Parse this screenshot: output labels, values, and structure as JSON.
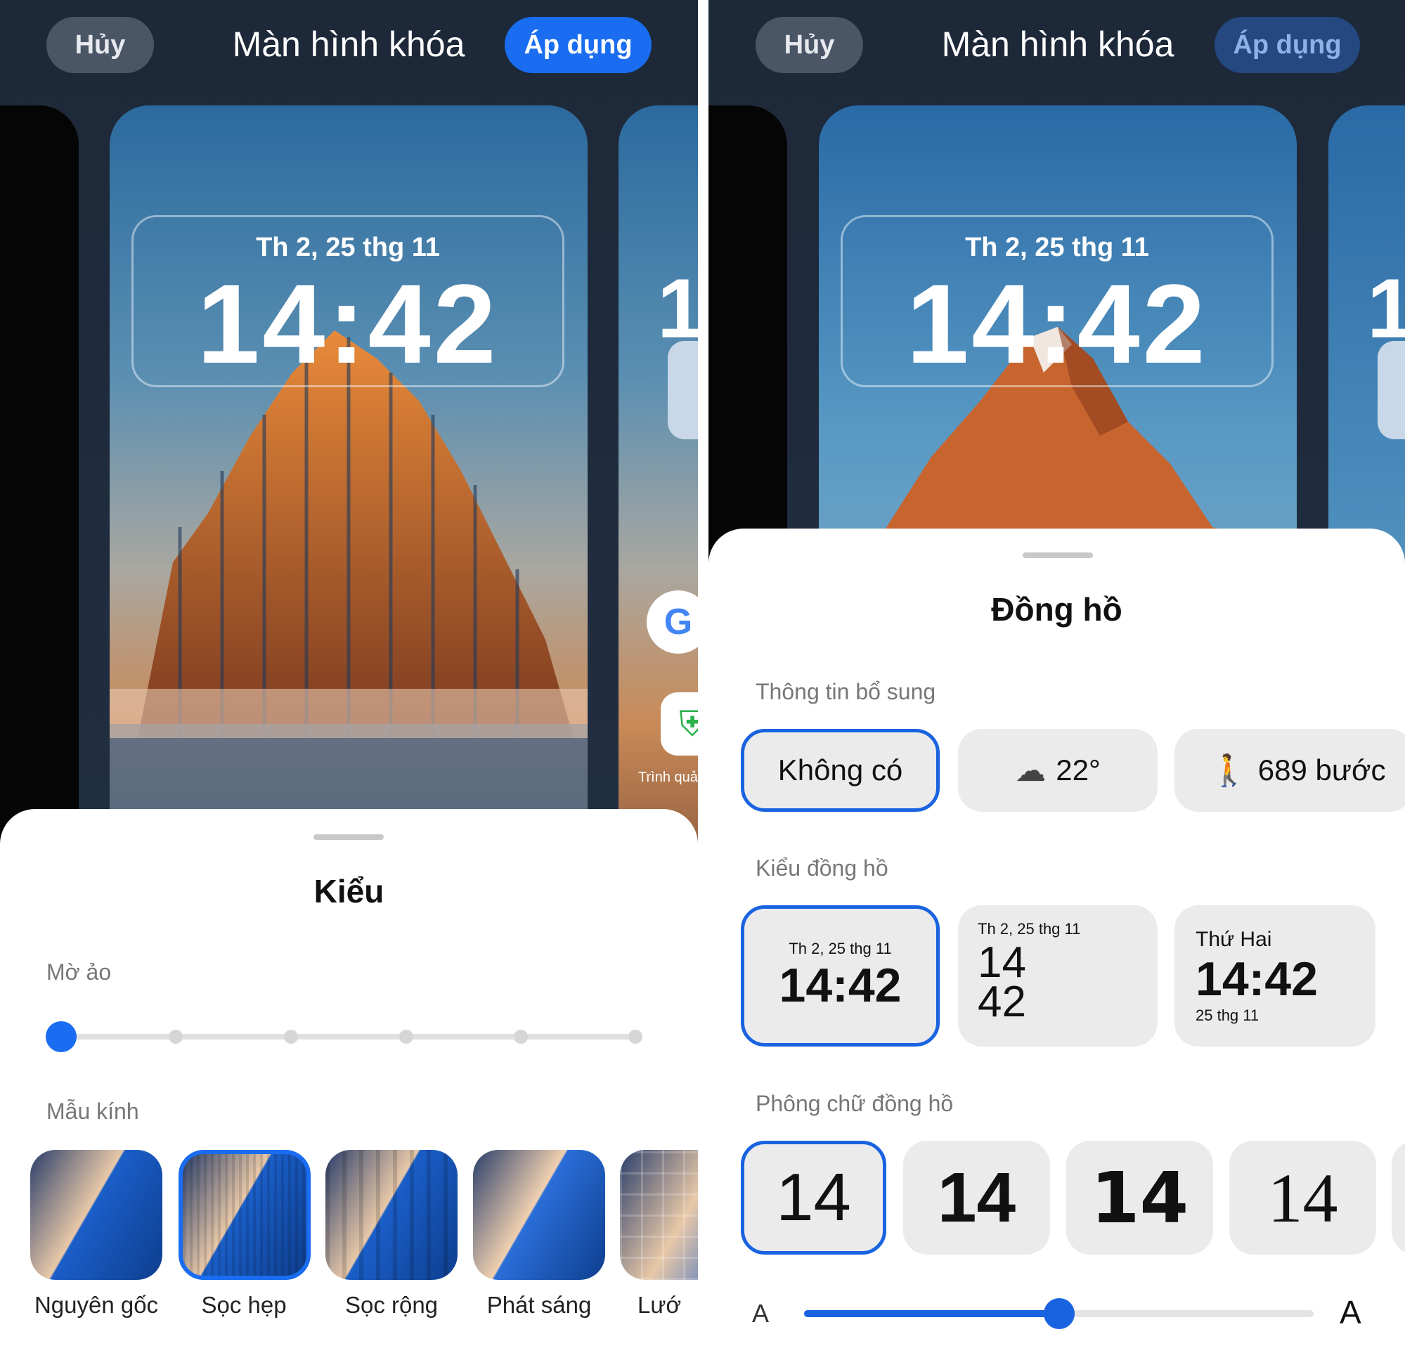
{
  "left": {
    "header": {
      "cancel": "Hủy",
      "title": "Màn hình khóa",
      "apply": "Áp dụng"
    },
    "preview": {
      "date": "Th 2, 25 thg 11",
      "time": "14:42",
      "side_digit": "1",
      "side_app_label": "Trình quả"
    },
    "sheet": {
      "title": "Kiểu",
      "blur_label": "Mờ ảo",
      "blur_level": 0,
      "blur_steps": 6,
      "glass_label": "Mẫu kính",
      "glass_options": [
        {
          "label": "Nguyên gốc",
          "selected": false
        },
        {
          "label": "Sọc hẹp",
          "selected": true
        },
        {
          "label": "Sọc rộng",
          "selected": false
        },
        {
          "label": "Phát sáng",
          "selected": false
        },
        {
          "label": "Lướ",
          "selected": false
        }
      ]
    },
    "accent": "#1a6df0"
  },
  "right": {
    "header": {
      "cancel": "Hủy",
      "title": "Màn hình khóa",
      "apply": "Áp dụng",
      "apply_enabled": false
    },
    "preview": {
      "date": "Th 2, 25 thg 11",
      "time": "14:42",
      "side_digit": "1"
    },
    "sheet": {
      "title": "Đồng hồ",
      "extra_label": "Thông tin bổ sung",
      "extra_options": [
        {
          "label": "Không có",
          "selected": true
        },
        {
          "icon": "cloud-icon",
          "label": "22°"
        },
        {
          "icon": "walking-icon",
          "label": "689 bước"
        }
      ],
      "style_label": "Kiểu đồng hồ",
      "styles": [
        {
          "date": "Th 2, 25 thg 11",
          "time": "14:42",
          "selected": true
        },
        {
          "date": "Th 2, 25 thg 11",
          "hour": "14",
          "minute": "42"
        },
        {
          "day": "Thứ Hai",
          "time": "14:42",
          "date": "25 thg 11"
        }
      ],
      "font_label": "Phông chữ đồng hồ",
      "fonts": [
        {
          "sample": "14",
          "selected": true
        },
        {
          "sample": "14"
        },
        {
          "sample": "14"
        },
        {
          "sample": "14"
        }
      ],
      "size_small": "A",
      "size_large": "A",
      "size_value": 0.5
    }
  }
}
